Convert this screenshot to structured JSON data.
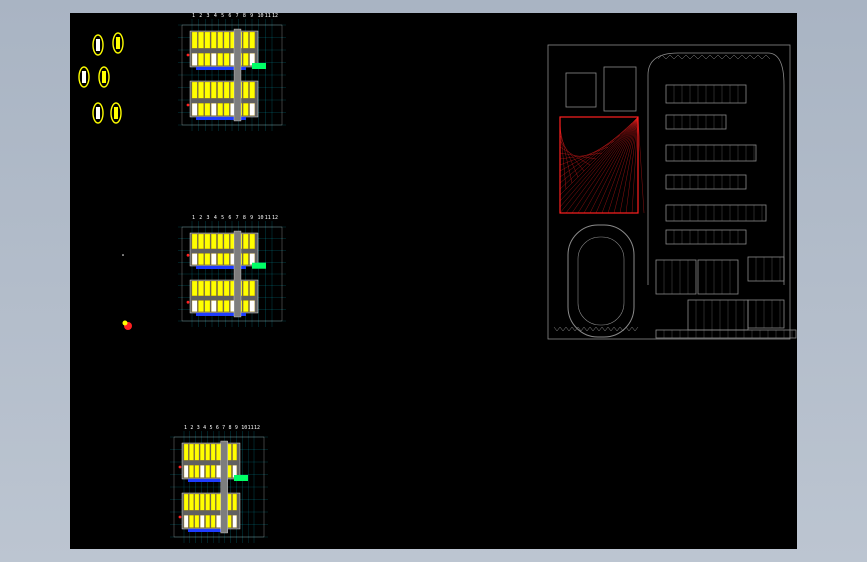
{
  "app": {
    "background_color": "#a9b4c3",
    "canvas_color": "#000000"
  },
  "drawing": {
    "colors": {
      "yellow": "#ffff00",
      "blue": "#1f3cff",
      "green": "#00ff66",
      "red": "#ff2020",
      "white": "#ffffff",
      "gray": "#8a8a8a",
      "cyan": "#00e5ff"
    },
    "plan_tick_labels": [
      "1",
      "2",
      "3",
      "4",
      "5",
      "6",
      "7",
      "8",
      "9",
      "10",
      "11",
      "12"
    ],
    "site_plan": {
      "highlight_color": "#ff2020"
    }
  }
}
